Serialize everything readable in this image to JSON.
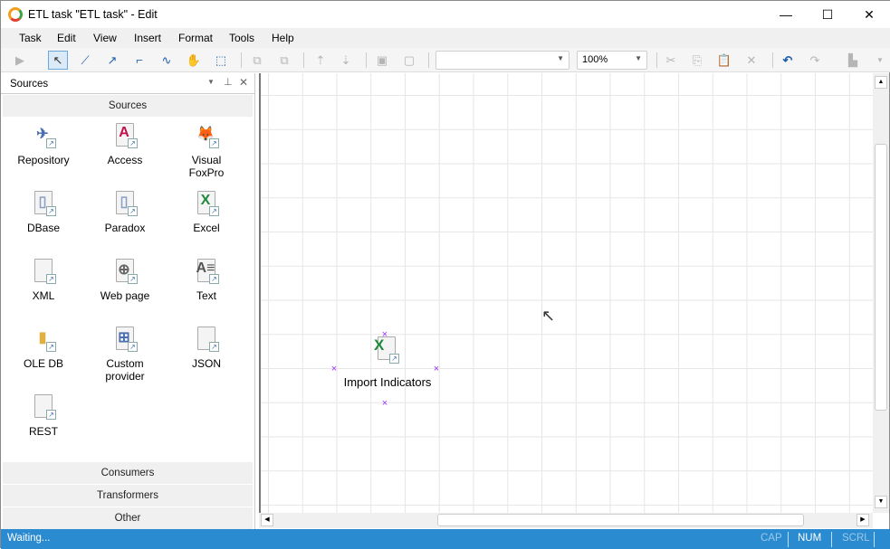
{
  "window": {
    "title": "ETL task \"ETL task\" - Edit",
    "minimize": "—",
    "maximize": "☐",
    "close": "✕"
  },
  "menu": [
    "Task",
    "Edit",
    "View",
    "Insert",
    "Format",
    "Tools",
    "Help"
  ],
  "toolbar": {
    "style_combo": "",
    "zoom": "100%"
  },
  "panel": {
    "title": "Sources",
    "group": "Sources",
    "items": [
      {
        "label": "Repository",
        "icon": "paper-plane-icon"
      },
      {
        "label": "Access",
        "icon": "access-icon"
      },
      {
        "label": "Visual FoxPro",
        "icon": "fox-icon"
      },
      {
        "label": "DBase",
        "icon": "database-file-icon"
      },
      {
        "label": "Paradox",
        "icon": "database-file-icon"
      },
      {
        "label": "Excel",
        "icon": "excel-icon"
      },
      {
        "label": "XML",
        "icon": "code-icon"
      },
      {
        "label": "Web page",
        "icon": "globe-icon"
      },
      {
        "label": "Text",
        "icon": "text-file-icon"
      },
      {
        "label": "OLE DB",
        "icon": "cylinder-icon"
      },
      {
        "label": "Custom provider",
        "icon": "custom-provider-icon"
      },
      {
        "label": "JSON",
        "icon": "code-icon"
      },
      {
        "label": "REST",
        "icon": "code-icon"
      }
    ],
    "groups": [
      "Consumers",
      "Transformers",
      "Other"
    ]
  },
  "canvas": {
    "node": {
      "label": "Import Indicators",
      "icon": "excel-icon"
    }
  },
  "status": {
    "text": "Waiting...",
    "cap": "CAP",
    "num": "NUM",
    "scrl": "SCRL"
  },
  "colors": {
    "status_bar": "#2a8bd0",
    "handle": "#9b30ff",
    "excel": "#1f8a3b"
  }
}
